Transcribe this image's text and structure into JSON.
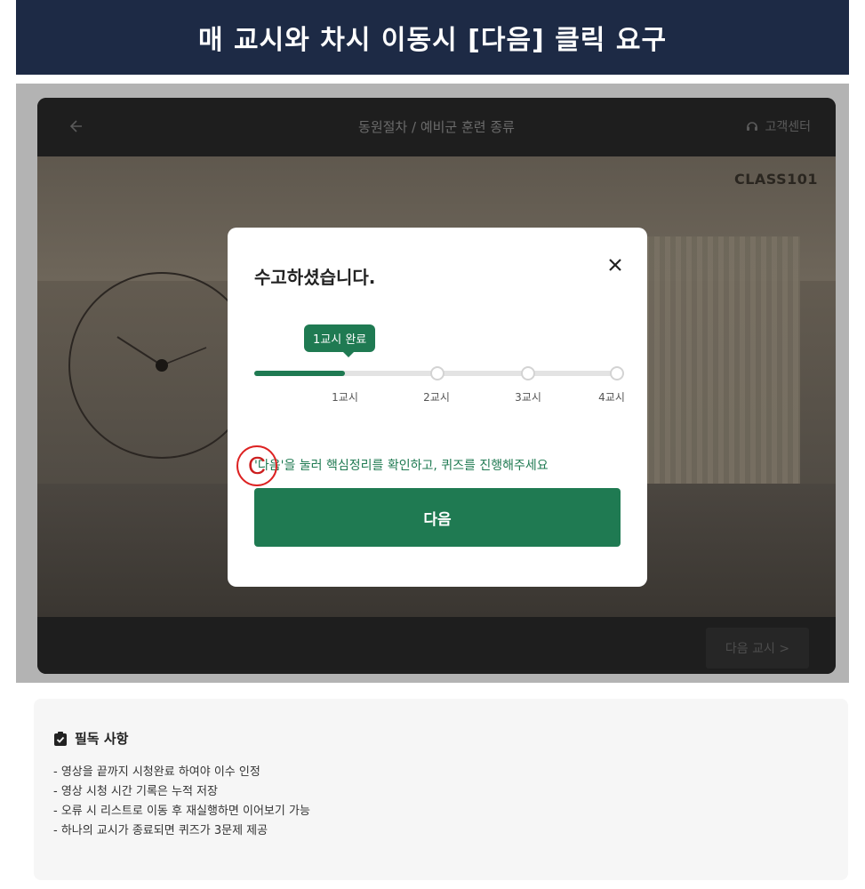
{
  "banner": {
    "title": "매 교시와 차시 이동시 [다음] 클릭 요구"
  },
  "player": {
    "title": "동원절차 / 예비군 훈련 종류",
    "support_label": "고객센터",
    "watermark": "CLASS101",
    "next_class_label": "다음 교시 >"
  },
  "modal": {
    "title": "수고하셨습니다.",
    "badge": "1교시 완료",
    "progress_fraction": 0.25,
    "steps": [
      "1교시",
      "2교시",
      "3교시",
      "4교시"
    ],
    "hint": "'다음'을 눌러 핵심정리를 확인하고, 퀴즈를 진행해주세요",
    "hint_marker": "C",
    "next_button": "다음"
  },
  "notice": {
    "title": "필독 사항",
    "items": [
      "- 영상을 끝까지 시청완료 하여야 이수 인정",
      "- 영상 시청 시간 기록은 누적 저장",
      "- 오류 시 리스트로 이동 후 재실행하면 이어보기 가능",
      "- 하나의 교시가 종료되면 퀴즈가 3문제 제공"
    ]
  },
  "colors": {
    "banner_bg": "#1d2a45",
    "accent_green": "#1f7a52",
    "marker_red": "#cc1f1f"
  }
}
